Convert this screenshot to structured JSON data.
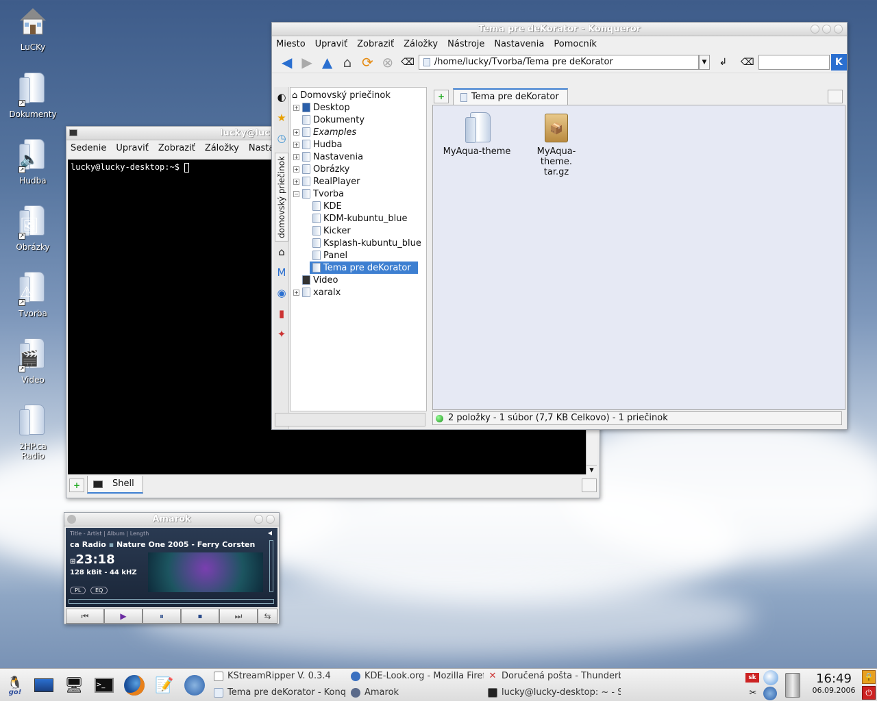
{
  "desktop": {
    "icons": [
      {
        "label": "LuCKy",
        "icon": "home-icon"
      },
      {
        "label": "Dokumenty",
        "icon": "folder-icon"
      },
      {
        "label": "Hudba",
        "icon": "music-folder-icon"
      },
      {
        "label": "Obrázky",
        "icon": "images-folder-icon"
      },
      {
        "label": "Tvorba",
        "icon": "work-folder-icon"
      },
      {
        "label": "Video",
        "icon": "video-folder-icon"
      },
      {
        "label": "2HP.ca Radio",
        "icon": "folder-icon"
      }
    ]
  },
  "konqueror": {
    "title": "Tema pre deKorator - Konqueror",
    "menu": [
      "Miesto",
      "Upraviť",
      "Zobraziť",
      "Záložky",
      "Nástroje",
      "Nastavenia",
      "Pomocník"
    ],
    "location": "/home/lucky/Tvorba/Tema pre deKorator",
    "search_value": "",
    "sidebar_tab": "domovský priečinok",
    "tree": {
      "root": "Domovský priečinok",
      "items": [
        "Desktop",
        "Dokumenty",
        "Examples",
        "Hudba",
        "Nastavenia",
        "Obrázky",
        "RealPlayer",
        "Tvorba"
      ],
      "tvorba_children": [
        "KDE",
        "KDM-kubuntu_blue",
        "Kicker",
        "Ksplash-kubuntu_blue",
        "Panel",
        "Tema pre deKorator"
      ],
      "after": [
        "Video",
        "xaralx"
      ]
    },
    "tab_label": "Tema pre deKorator",
    "files": [
      {
        "name": "MyAqua-theme",
        "icon": "folder-icon"
      },
      {
        "name": "MyAqua-theme.tar.gz",
        "name_line1": "MyAqua-theme.",
        "name_line2": "tar.gz",
        "icon": "archive-icon"
      }
    ],
    "status": "2 položky - 1 súbor (7,7 KB Celkovo) - 1 priečinok"
  },
  "konsole": {
    "title": "lucky@luck",
    "menu": [
      "Sedenie",
      "Upraviť",
      "Zobraziť",
      "Záložky",
      "Nastav"
    ],
    "prompt": "lucky@lucky-desktop:~$ ",
    "tab_label": "Shell"
  },
  "amarok": {
    "title": "Amarok",
    "header": "Title - Artist | Album | Length",
    "scroll_text_left": "ca Radio",
    "scroll_text_right": "Nature One 2005 - Ferry Corsten",
    "time": "23:18",
    "bitrate": "128 kBit - 44 kHZ",
    "pl_label": "PL",
    "eq_label": "EQ"
  },
  "taskbar": {
    "go_label": "go!",
    "tasks_top": [
      "KStreamRipper V. 0.3.4",
      "KDE-Look.org - Mozilla Firefo",
      "Doručená pošta - Thunderb"
    ],
    "tasks_bottom": [
      "Tema pre deKorator - Konq",
      "Amarok",
      "lucky@lucky-desktop: ~ - Sh"
    ],
    "tray_lang": "sk",
    "time": "16:49",
    "date": "06.09.2006"
  },
  "colors": {
    "selection": "#3d7fd1",
    "file_view_bg": "#e6e9f4"
  }
}
